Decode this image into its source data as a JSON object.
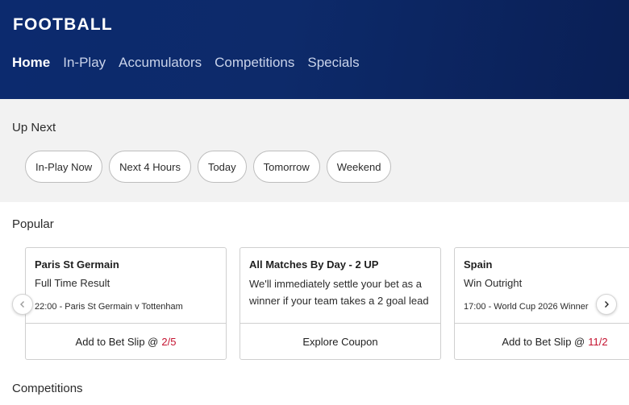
{
  "header": {
    "title": "FOOTBALL",
    "tabs": [
      {
        "label": "Home",
        "active": true
      },
      {
        "label": "In-Play",
        "active": false
      },
      {
        "label": "Accumulators",
        "active": false
      },
      {
        "label": "Competitions",
        "active": false
      },
      {
        "label": "Specials",
        "active": false
      }
    ]
  },
  "up_next": {
    "title": "Up Next",
    "chips": [
      "In-Play Now",
      "Next 4 Hours",
      "Today",
      "Tomorrow",
      "Weekend"
    ]
  },
  "popular": {
    "title": "Popular",
    "cards": [
      {
        "title": "Paris St Germain",
        "market": "Full Time Result",
        "meta": "22:00 - Paris St Germain v Tottenham",
        "action": "Add to Bet Slip @",
        "odds": "2/5"
      },
      {
        "title": "All Matches By Day - 2 UP",
        "description": "We'll immediately settle your bet as a winner if your team takes a 2 goal lead",
        "action": "Explore Coupon"
      },
      {
        "title": "Spain",
        "market": "Win Outright",
        "meta": "17:00 - World Cup 2026 Winner",
        "action": "Add to Bet Slip @",
        "odds": "11/2"
      }
    ],
    "prev_icon": "chevron-left-icon",
    "next_icon": "chevron-right-icon"
  },
  "competitions": {
    "title": "Competitions"
  },
  "colors": {
    "header_bg": "#0c2a6e",
    "odds": "#c4122f",
    "band_bg": "#f2f2f2"
  }
}
